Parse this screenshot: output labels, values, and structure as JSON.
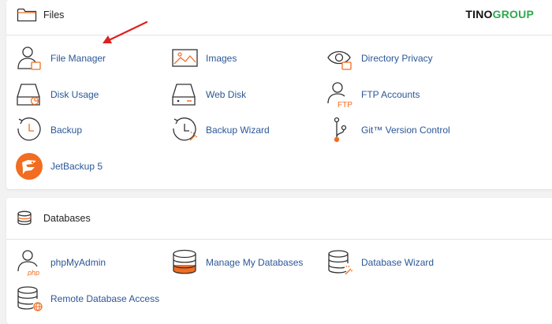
{
  "brand": {
    "part1": "TINO",
    "part2": "GROUP"
  },
  "files": {
    "title": "Files",
    "items": [
      {
        "label": "File Manager",
        "icon": "file-manager-icon"
      },
      {
        "label": "Images",
        "icon": "images-icon"
      },
      {
        "label": "Directory Privacy",
        "icon": "directory-privacy-icon"
      },
      {
        "label": "Disk Usage",
        "icon": "disk-usage-icon"
      },
      {
        "label": "Web Disk",
        "icon": "web-disk-icon"
      },
      {
        "label": "FTP Accounts",
        "icon": "ftp-accounts-icon"
      },
      {
        "label": "Backup",
        "icon": "backup-icon"
      },
      {
        "label": "Backup Wizard",
        "icon": "backup-wizard-icon"
      },
      {
        "label": "Git™ Version Control",
        "icon": "git-icon"
      },
      {
        "label": "JetBackup 5",
        "icon": "jetbackup-icon"
      }
    ]
  },
  "databases": {
    "title": "Databases",
    "items": [
      {
        "label": "phpMyAdmin",
        "icon": "phpmyadmin-icon"
      },
      {
        "label": "Manage My Databases",
        "icon": "manage-databases-icon"
      },
      {
        "label": "Database Wizard",
        "icon": "database-wizard-icon"
      },
      {
        "label": "Remote Database Access",
        "icon": "remote-database-icon"
      }
    ]
  },
  "icon_text": {
    "ftp": "FTP",
    "php": "php"
  },
  "colors": {
    "accent": "#f26d21",
    "link": "#2b5797",
    "arrow": "#e02020",
    "brand_green": "#2fa84f"
  }
}
